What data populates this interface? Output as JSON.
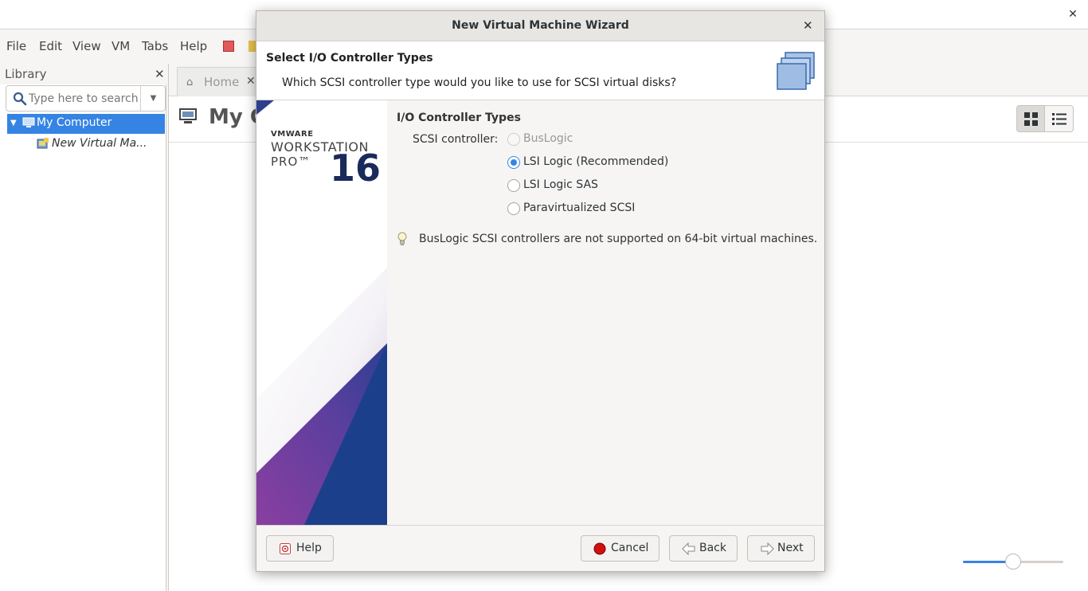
{
  "window": {
    "menu": [
      "File",
      "Edit",
      "View",
      "VM",
      "Tabs",
      "Help"
    ]
  },
  "library": {
    "title": "Library",
    "search_placeholder": "Type here to search",
    "tree": {
      "root_label": "My Computer",
      "vm_label": "New Virtual Ma..."
    }
  },
  "tabs": {
    "home_label": "Home"
  },
  "content": {
    "heading": "My Co",
    "zoom_level": 0.5
  },
  "dialog": {
    "title": "New Virtual Machine Wizard",
    "header_title": "Select I/O Controller Types",
    "header_subtitle": "Which SCSI controller type would you like to use for SCSI virtual disks?",
    "banner": {
      "vendor": "VMWARE",
      "product": "WORKSTATION",
      "edition": "PRO™",
      "version": "16"
    },
    "section_title": "I/O Controller Types",
    "scsi_label": "SCSI controller:",
    "options": [
      {
        "label": "BusLogic",
        "state": "disabled"
      },
      {
        "label": "LSI Logic (Recommended)",
        "state": "checked"
      },
      {
        "label": "LSI Logic SAS",
        "state": "unchecked"
      },
      {
        "label": "Paravirtualized SCSI",
        "state": "unchecked"
      }
    ],
    "note": "BusLogic SCSI controllers are not supported on 64-bit virtual machines.",
    "buttons": {
      "help": "Help",
      "cancel": "Cancel",
      "back": "Back",
      "next": "Next"
    }
  },
  "colors": {
    "accent": "#3584e4",
    "banner_blue": "#1c3f8c",
    "banner_purple": "#7b3f9e"
  }
}
